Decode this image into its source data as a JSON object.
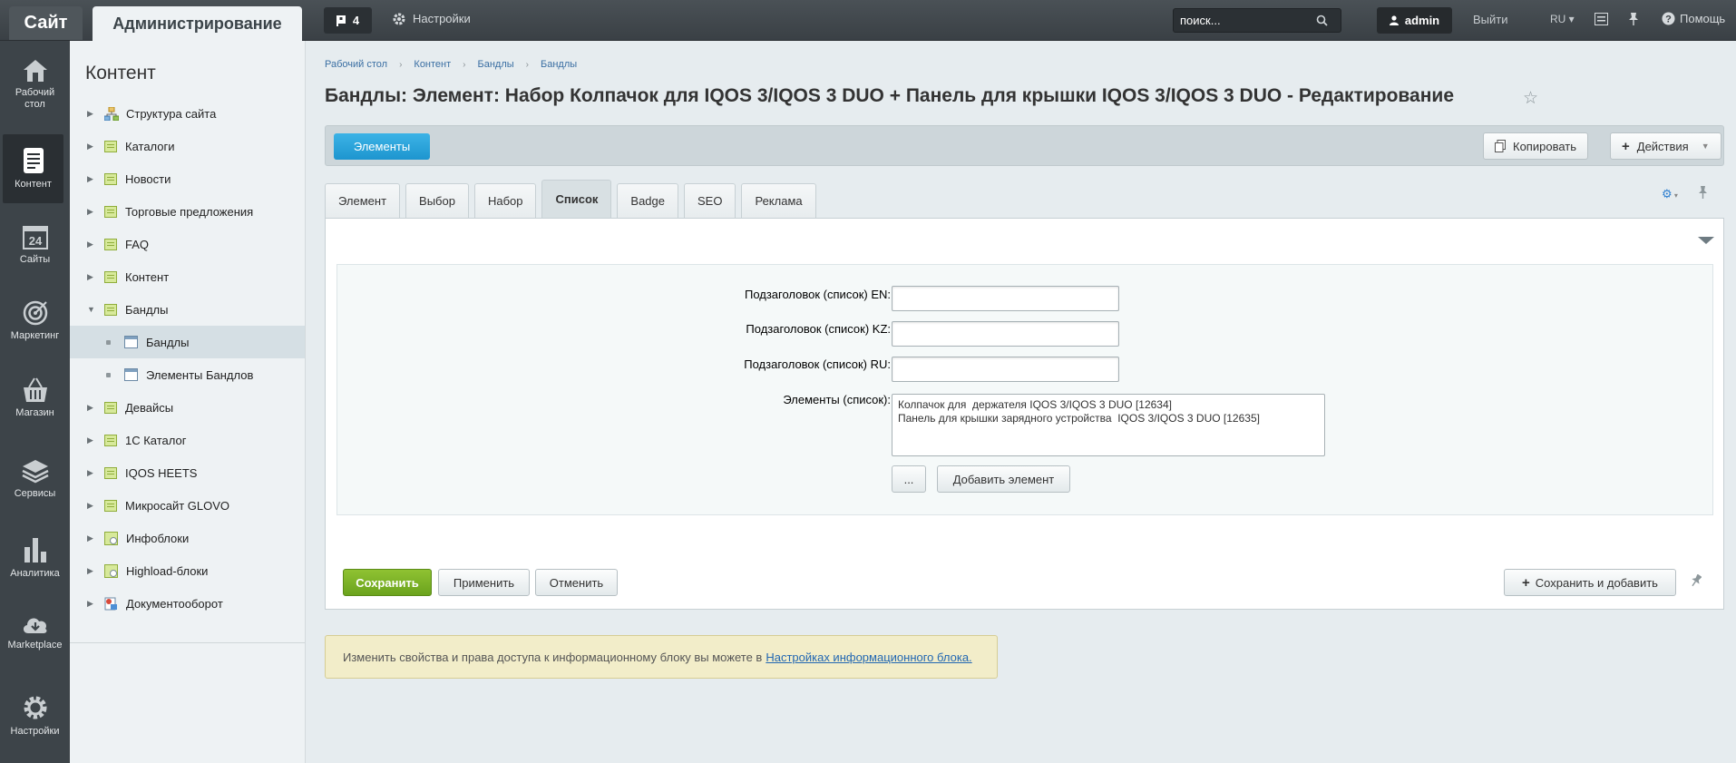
{
  "topbar": {
    "site_tab": "Сайт",
    "admin_tab": "Администрирование",
    "notify_count": "4",
    "settings": "Настройки",
    "search_placeholder": "поиск...",
    "user": "admin",
    "logout": "Выйти",
    "lang": "RU",
    "help": "Помощь"
  },
  "leftpanel": [
    {
      "label": "Рабочий стол",
      "icon": "home-icon"
    },
    {
      "label": "Контент",
      "icon": "document-icon"
    },
    {
      "label": "Сайты",
      "icon": "calendar-24-icon"
    },
    {
      "label": "Маркетинг",
      "icon": "target-icon"
    },
    {
      "label": "Магазин",
      "icon": "basket-icon"
    },
    {
      "label": "Сервисы",
      "icon": "layers-icon"
    },
    {
      "label": "Аналитика",
      "icon": "bar-chart-icon"
    },
    {
      "label": "Marketplace",
      "icon": "cloud-download-icon"
    },
    {
      "label": "Настройки",
      "icon": "gear-icon"
    }
  ],
  "tree": {
    "title": "Контент",
    "items": [
      {
        "label": "Структура сайта"
      },
      {
        "label": "Каталоги"
      },
      {
        "label": "Новости"
      },
      {
        "label": "Торговые предложения"
      },
      {
        "label": "FAQ"
      },
      {
        "label": "Контент"
      },
      {
        "label": "Бандлы"
      },
      {
        "label": "Бандлы"
      },
      {
        "label": "Элементы Бандлов"
      },
      {
        "label": "Девайсы"
      },
      {
        "label": "1С Каталог"
      },
      {
        "label": "IQOS HEETS"
      },
      {
        "label": "Микросайт GLOVO"
      },
      {
        "label": "Инфоблоки"
      },
      {
        "label": "Highload-блоки"
      },
      {
        "label": "Документооборот"
      }
    ]
  },
  "breadcrumb": [
    "Рабочий стол",
    "Контент",
    "Бандлы",
    "Бандлы"
  ],
  "page_title": "Бандлы: Элемент: Набор Колпачок для IQOS 3/IQOS 3 DUO + Панель для крышки IQOS 3/IQOS 3 DUO - Редактирование",
  "toolbar": {
    "elements": "Элементы",
    "copy": "Копировать",
    "actions": "Действия"
  },
  "tabs": [
    "Элемент",
    "Выбор",
    "Набор",
    "Список",
    "Badge",
    "SEO",
    "Реклама"
  ],
  "form": {
    "label_en": "Подзаголовок (список) EN:",
    "label_kz": "Подзаголовок (список) KZ:",
    "label_ru": "Подзаголовок (список) RU:",
    "value_en": "",
    "value_kz": "",
    "value_ru": "",
    "label_elements": "Элементы (список):",
    "elements_line1": "Колпачок для  держателя IQOS 3/IQOS 3 DUO [12634]",
    "elements_line2": "Панель для крышки зарядного устройства  IQOS 3/IQOS 3 DUO [12635]",
    "browse": "...",
    "add_element": "Добавить элемент"
  },
  "actions": {
    "save": "Сохранить",
    "apply": "Применить",
    "cancel": "Отменить",
    "save_and_add": "Сохранить и добавить"
  },
  "notice": {
    "text": "Изменить свойства и права доступа к информационному блоку вы можете в",
    "link": "Настройках информационного блока."
  }
}
